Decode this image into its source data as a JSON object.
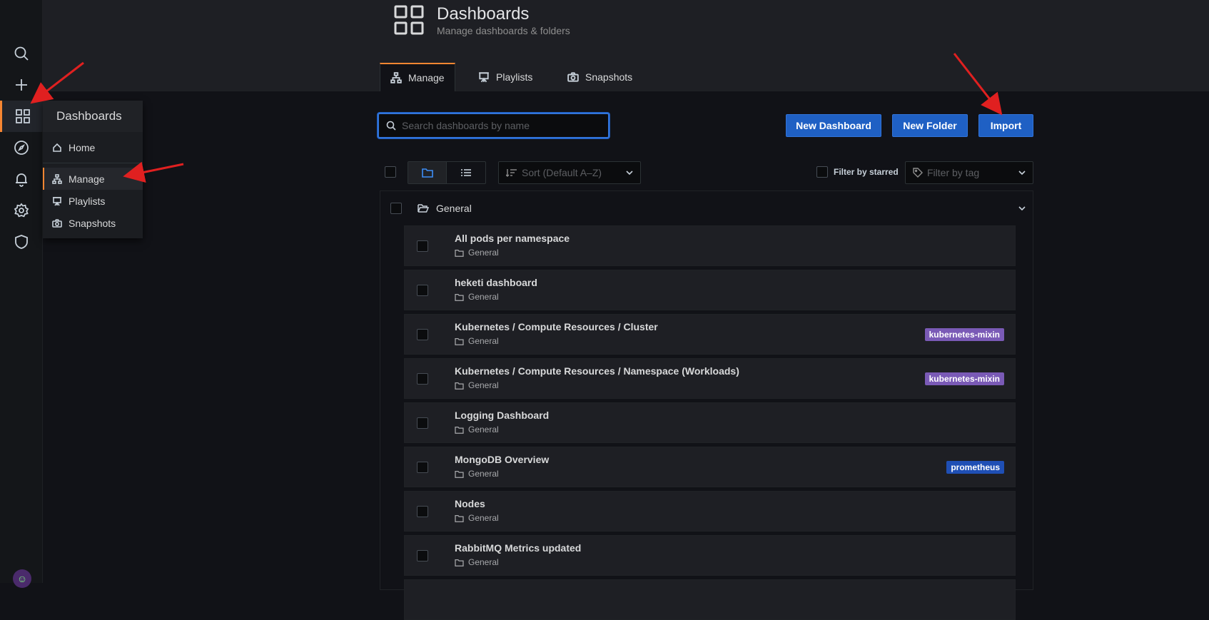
{
  "sidemenu": {
    "items": [
      {
        "icon": "search-icon"
      },
      {
        "icon": "plus-icon"
      },
      {
        "icon": "dashboards-icon",
        "active": true
      },
      {
        "icon": "compass-icon"
      },
      {
        "icon": "bell-icon"
      },
      {
        "icon": "gear-icon"
      },
      {
        "icon": "shield-icon"
      }
    ],
    "accent_color": "#f68632"
  },
  "dropdown": {
    "title": "Dashboards",
    "items": [
      {
        "label": "Home",
        "icon": "home-icon"
      },
      {
        "label": "Manage",
        "icon": "sitemap-icon",
        "active": true
      },
      {
        "label": "Playlists",
        "icon": "presentation-icon"
      },
      {
        "label": "Snapshots",
        "icon": "camera-icon"
      }
    ]
  },
  "header": {
    "title": "Dashboards",
    "subtitle": "Manage dashboards & folders",
    "tabs": [
      {
        "label": "Manage",
        "icon": "sitemap-icon",
        "active": true
      },
      {
        "label": "Playlists",
        "icon": "presentation-icon"
      },
      {
        "label": "Snapshots",
        "icon": "camera-icon"
      }
    ]
  },
  "search": {
    "placeholder": "Search dashboards by name",
    "value": ""
  },
  "actions": {
    "new_dashboard": "New Dashboard",
    "new_folder": "New Folder",
    "import": "Import"
  },
  "toolbar": {
    "sort_placeholder": "Sort (Default A–Z)",
    "filter_starred": "Filter by starred",
    "filter_tag_placeholder": "Filter by tag"
  },
  "folder": {
    "name": "General"
  },
  "dashboards": [
    {
      "title": "All pods per namespace",
      "folder": "General",
      "tag": ""
    },
    {
      "title": "heketi dashboard",
      "folder": "General",
      "tag": ""
    },
    {
      "title": "Kubernetes / Compute Resources / Cluster",
      "folder": "General",
      "tag": "kubernetes-mixin",
      "tag_color": "#7a5ab6"
    },
    {
      "title": "Kubernetes / Compute Resources / Namespace (Workloads)",
      "folder": "General",
      "tag": "kubernetes-mixin",
      "tag_color": "#7a5ab6"
    },
    {
      "title": "Logging Dashboard",
      "folder": "General",
      "tag": ""
    },
    {
      "title": "MongoDB Overview",
      "folder": "General",
      "tag": "prometheus",
      "tag_color": "#1f4fb5"
    },
    {
      "title": "Nodes",
      "folder": "General",
      "tag": ""
    },
    {
      "title": "RabbitMQ Metrics updated",
      "folder": "General",
      "tag": ""
    }
  ],
  "colors": {
    "primary_button": "#1f60c4",
    "annotation_arrow": "#e02020"
  }
}
